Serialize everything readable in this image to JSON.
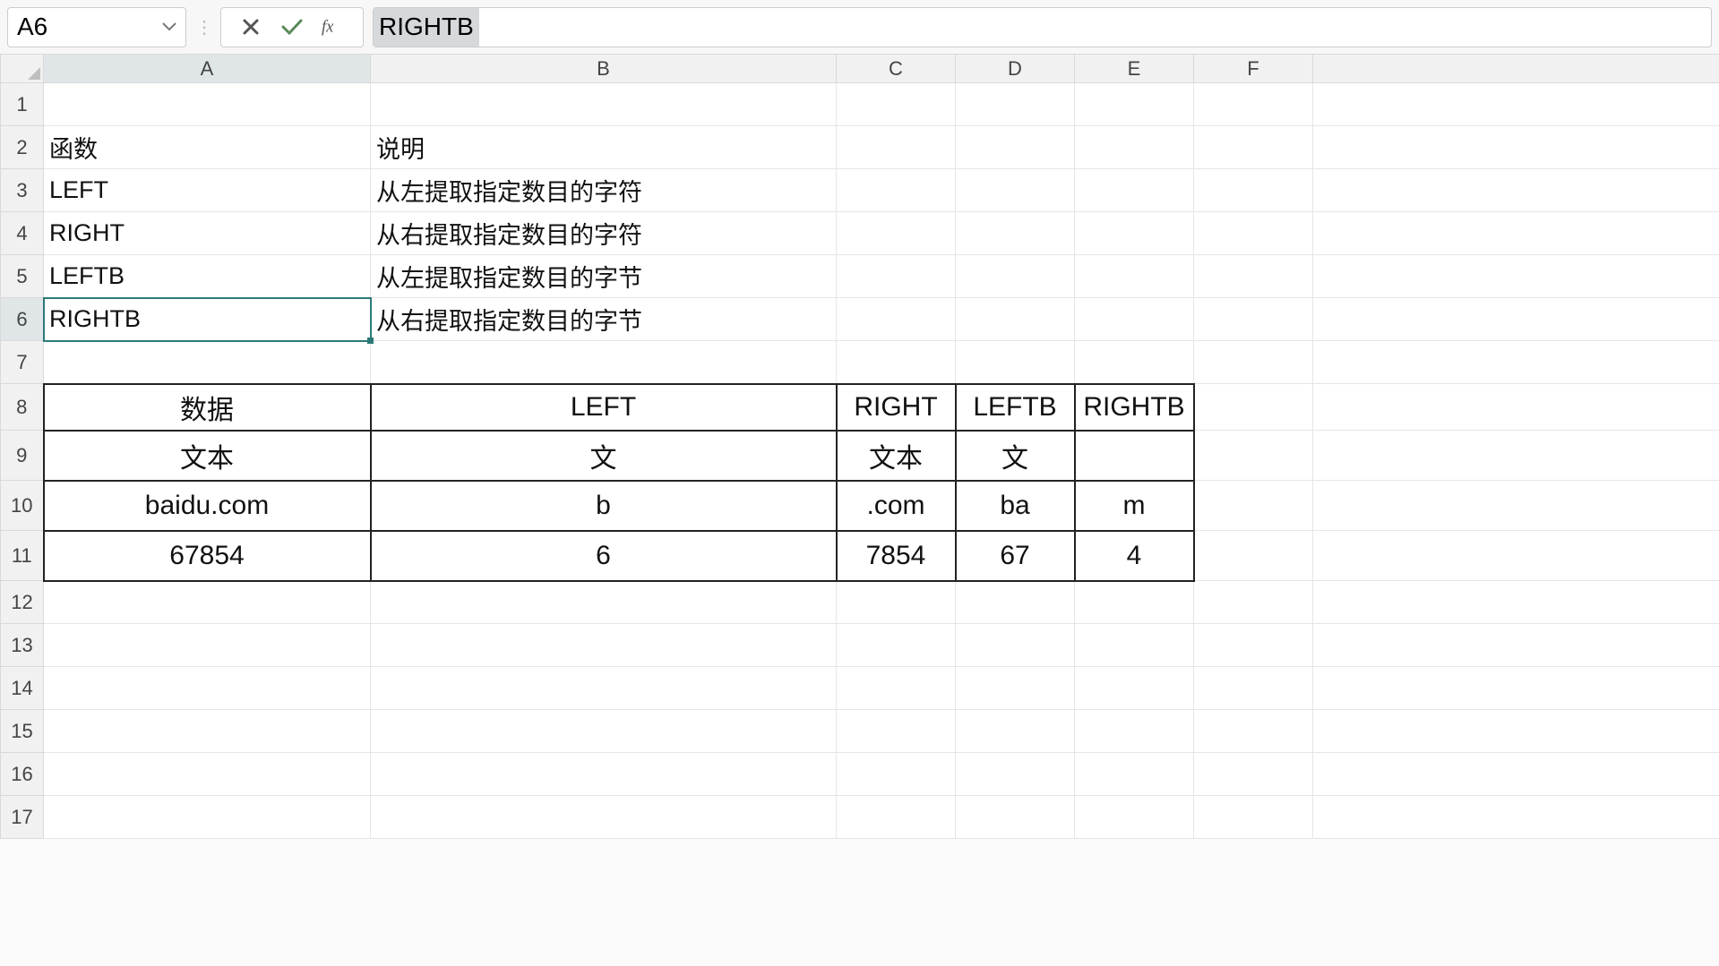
{
  "namebox": {
    "value": "A6"
  },
  "formula_bar": {
    "content": "RIGHTB"
  },
  "columns": [
    "A",
    "B",
    "C",
    "D",
    "E",
    "F"
  ],
  "rows": [
    "1",
    "2",
    "3",
    "4",
    "5",
    "6",
    "7",
    "8",
    "9",
    "10",
    "11",
    "12",
    "13",
    "14",
    "15",
    "16",
    "17"
  ],
  "selected_cell": "A6",
  "data_raw": {
    "A2": "函数",
    "B2": "说明",
    "A3": "LEFT",
    "B3": "从左提取指定数目的字符",
    "A4": "RIGHT",
    "B4": "从右提取指定数目的字符",
    "A5": "LEFTB",
    "B5": "从左提取指定数目的字节",
    "A6": "RIGHTB",
    "B6": "从右提取指定数目的字节"
  },
  "table": {
    "headers": {
      "A8": "数据",
      "B8": "LEFT",
      "C8": "RIGHT",
      "D8": "LEFTB",
      "E8": "RIGHTB"
    },
    "cells": {
      "A9": "文本",
      "B9": "文",
      "C9": "文本",
      "D9": "文",
      "E9": "",
      "A10": "baidu.com",
      "B10": "b",
      "C10": ".com",
      "D10": "ba",
      "E10": "m",
      "A11": "67854",
      "B11": "6",
      "C11": "7854",
      "D11": "67",
      "E11": "4"
    }
  }
}
